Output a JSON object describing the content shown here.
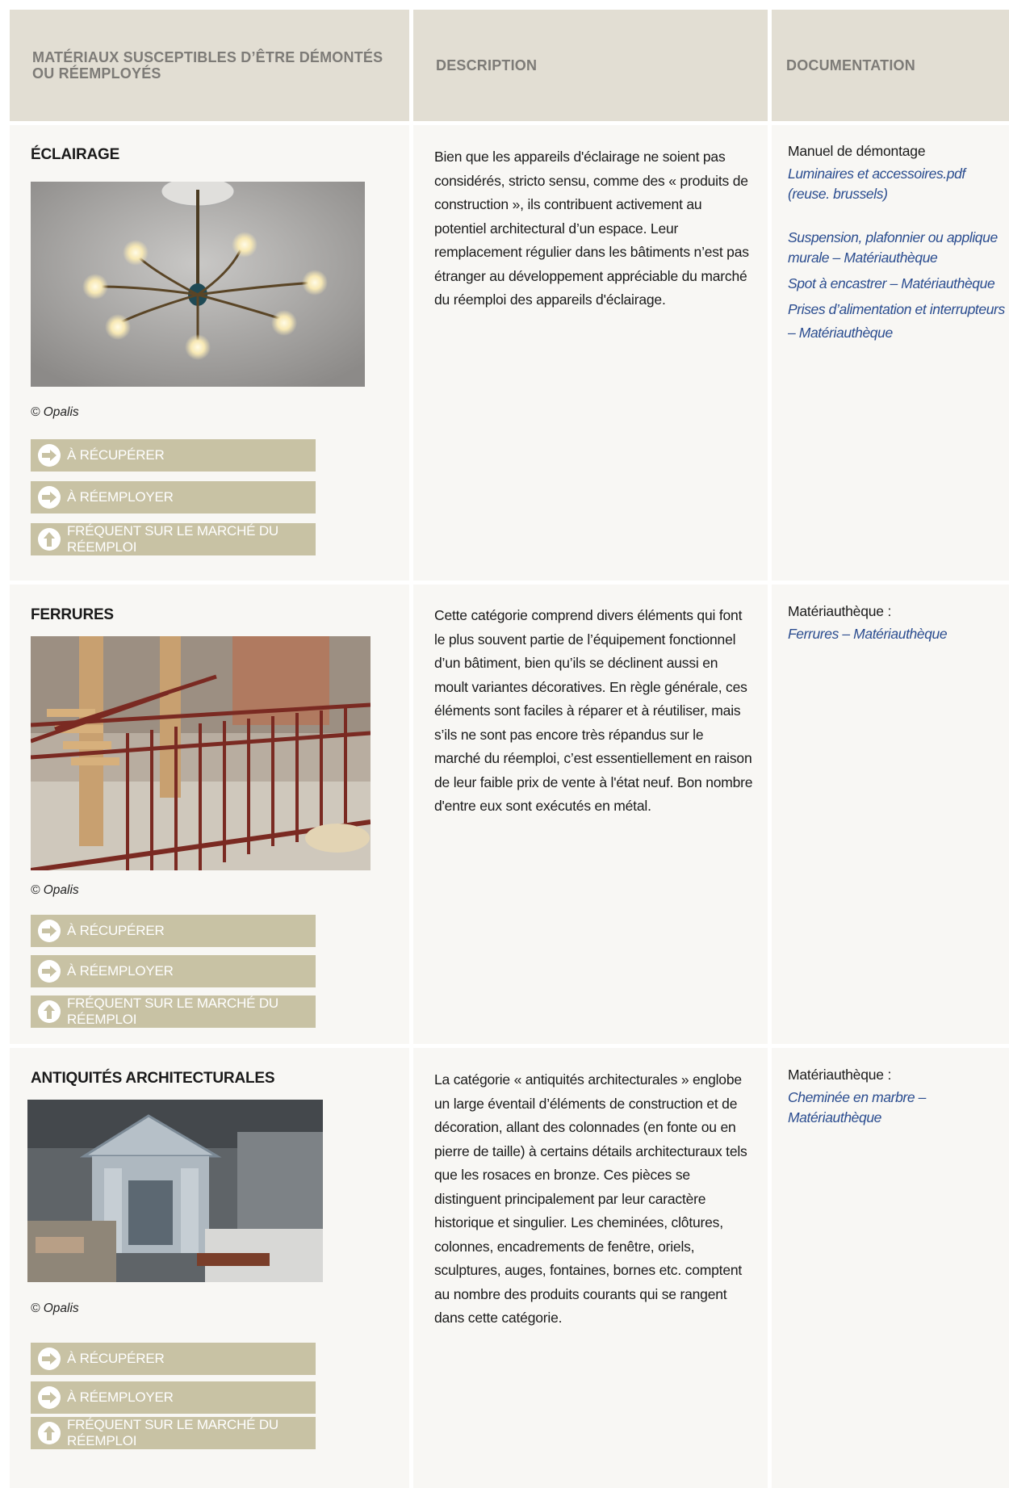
{
  "header": {
    "col1": "MATÉRIAUX SUSCEPTIBLES D’ÊTRE DÉMONTÉS OU RÉEMPLOYÉS",
    "col2": "DESCRIPTION",
    "col3": "DOCUMENTATION"
  },
  "tags": {
    "recover": "À RÉCUPÉRER",
    "reuse": "À RÉEMPLOYER",
    "frequent": "FRÉQUENT SUR LE MARCHÉ DU RÉEMPLOI"
  },
  "rows": [
    {
      "title": "ÉCLAIRAGE",
      "credit": "© Opalis",
      "description": "Bien que les appareils d'éclairage ne soient pas considérés, stricto sensu, comme des « produits de construction », ils contribuent activement au potentiel architectural d’un espace. Leur remplacement régulier dans les bâtiments n’est pas étranger au développement appréciable du marché du réemploi des appareils d'éclairage.",
      "doc_label": "Manuel de démontage",
      "links": [
        "Luminaires et accessoires.pdf (reuse. brussels)",
        "Suspension, plafonnier ou applique murale – Matériauthèque",
        "Spot à encastrer – Matériauthèque",
        "Prises d’alimentation et interrupteurs – Matériauthèque"
      ]
    },
    {
      "title": "FERRURES",
      "credit": "© Opalis",
      "description": "Cette catégorie comprend divers éléments qui font le plus souvent partie de l’équipement fonctionnel d’un bâtiment, bien qu’ils se déclinent aussi en moult variantes décoratives. En règle générale, ces éléments sont faciles à réparer et à réutiliser, mais s’ils ne sont pas encore très répandus sur le marché du réemploi, c’est essentiellement en raison de leur faible prix de vente à l'état neuf. Bon nombre d'entre eux sont exécutés en métal.",
      "doc_label": "Matériauthèque :",
      "links": [
        "Ferrures – Matériauthèque"
      ]
    },
    {
      "title": "ANTIQUITÉS ARCHITECTURALES",
      "credit": "© Opalis",
      "description": "La catégorie « antiquités architecturales » englobe un large éventail d’éléments de construction et de décoration, allant des colonnades (en fonte ou en pierre de taille) à certains détails architecturaux tels que les rosaces en bronze. Ces pièces se distinguent principalement par leur caractère historique et singulier. Les cheminées, clôtures, colonnes, encadrements de fenêtre, oriels, sculptures, auges, fontaines, bornes etc. comptent au nombre des produits courants qui se rangent dans cette catégorie.",
      "doc_label": "Matériauthèque :",
      "links": [
        "Cheminée en marbre – Matériauthèque"
      ]
    }
  ]
}
